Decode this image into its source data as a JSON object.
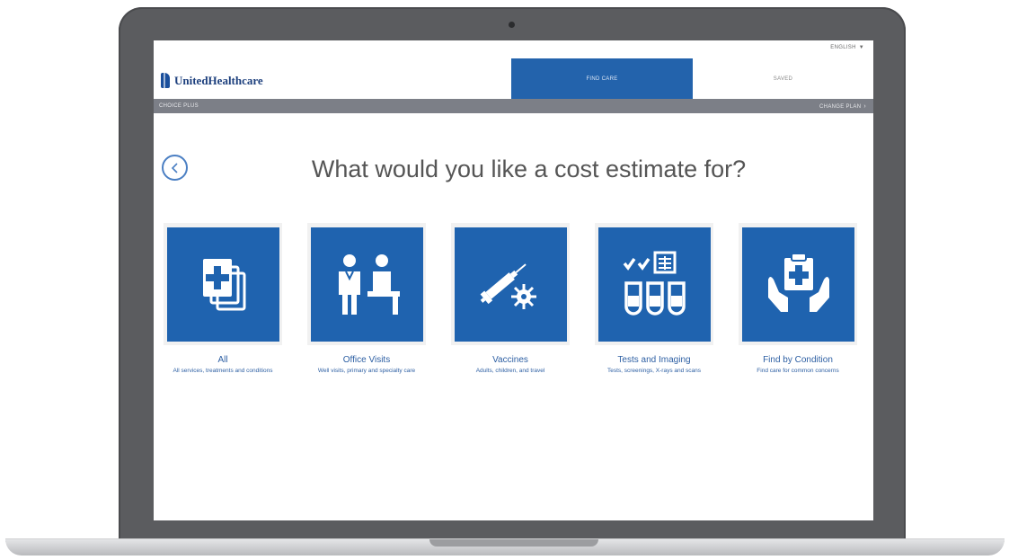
{
  "header": {
    "language": "ENGLISH",
    "brand": "UnitedHealthcare",
    "tabs": [
      {
        "label": "FIND CARE",
        "active": true
      },
      {
        "label": "SAVED",
        "active": false
      }
    ]
  },
  "subbar": {
    "left_label": "CHOICE PLUS",
    "right_label": "CHANGE PLAN"
  },
  "main": {
    "heading": "What would you like a cost estimate for?",
    "cards": [
      {
        "title": "All",
        "description": "All services, treatments and conditions",
        "icon": "documents-plus-icon"
      },
      {
        "title": "Office Visits",
        "description": "Well visits, primary and specialty care",
        "icon": "doctor-patient-icon"
      },
      {
        "title": "Vaccines",
        "description": "Adults, children, and travel",
        "icon": "syringe-virus-icon"
      },
      {
        "title": "Tests and Imaging",
        "description": "Tests, screenings, X-rays and scans",
        "icon": "test-tubes-xray-icon"
      },
      {
        "title": "Find by Condition",
        "description": "Find care for common concerns",
        "icon": "hands-clipboard-icon"
      }
    ]
  },
  "colors": {
    "brand_blue": "#1f63af",
    "subbar_gray": "#7c7f87",
    "frame_gray": "#5b5c5f"
  }
}
